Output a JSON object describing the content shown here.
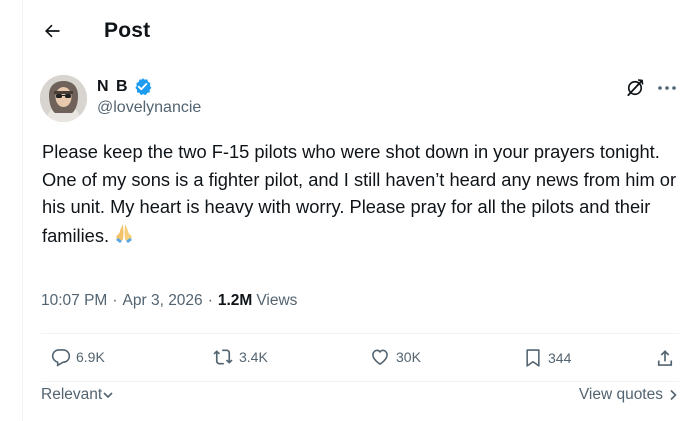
{
  "header": {
    "title": "Post",
    "back_icon": "arrow-left-icon"
  },
  "author": {
    "display_name": "N B",
    "handle": "@lovelynancie",
    "verified": true,
    "verified_color": "#1d9bf0"
  },
  "post": {
    "paragraph_1": "Please keep the two F-15 pilots who were shot down in your prayers tonight.",
    "paragraph_2": "One of my sons is a fighter pilot, and I still haven’t heard any news from him or his unit. My heart is heavy with worry. Please pray for all the pilots and their families.",
    "emoji_icon": "praying-hands-icon",
    "time": "10:07 PM",
    "date": "Apr 3, 2026",
    "separator": "·",
    "views_count": "1.2M",
    "views_label": "Views"
  },
  "actions": {
    "replies": "6.9K",
    "reposts": "3.4K",
    "likes": "30K",
    "bookmarks": "344"
  },
  "footer": {
    "sort_label": "Relevant",
    "view_quotes_label": "View quotes"
  },
  "colors": {
    "text": "#0f1419",
    "secondary": "#536471",
    "divider": "#eff3f4",
    "accent": "#1d9bf0"
  }
}
